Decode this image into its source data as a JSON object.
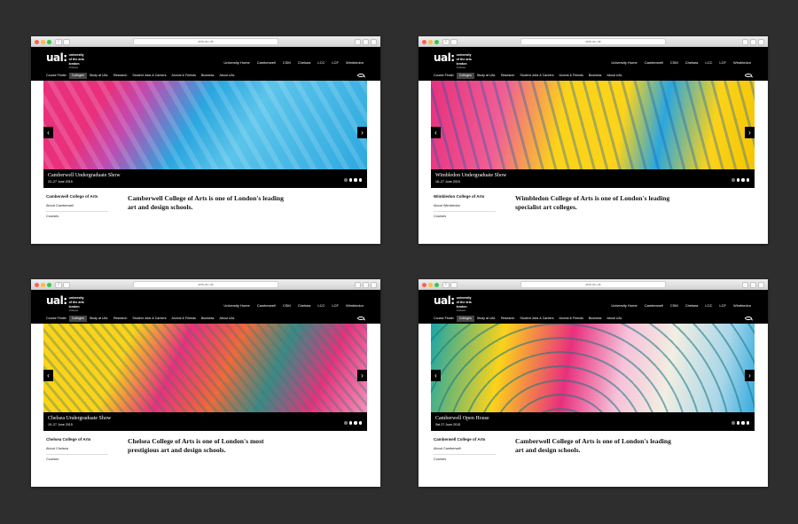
{
  "browser": {
    "url": "arts.ac.uk"
  },
  "header": {
    "logo_mark": "ual:",
    "logo_lines": [
      "university",
      "of the arts",
      "london"
    ],
    "logo_sub": "chelsea",
    "top_nav": [
      "University Home",
      "Camberwell",
      "CSM",
      "Chelsea",
      "LCC",
      "LCF",
      "Wimbledon"
    ],
    "main_nav": [
      "Course Finder",
      "Colleges",
      "Study at UAL",
      "Research",
      "Student Jobs & Careers",
      "Alumni & Friends",
      "Business",
      "About UAL"
    ],
    "active_nav": "Colleges"
  },
  "windows": [
    {
      "slide_title": "Camberwell Undergraduate Show",
      "slide_date": "22–27 June 2015",
      "sidebar_title": "Camberwell College of Arts",
      "sidebar_link": "About Camberwell",
      "sidebar_courses": "Courses",
      "intro": "Camberwell College of Arts is one of London's leading art and design schools.",
      "active_dot": 1
    },
    {
      "slide_title": "Wimbledon Undergraduate Show",
      "slide_date": "16–27 June 2015",
      "sidebar_title": "Wimbledon College of Arts",
      "sidebar_link": "About Wimbledon",
      "sidebar_courses": "Courses",
      "intro": "Wimbledon College of Arts is one of London's leading specialist art colleges.",
      "active_dot": 1
    },
    {
      "slide_title": "Chelsea Undergraduate Show",
      "slide_date": "19–27 June 2015",
      "sidebar_title": "Chelsea College of Arts",
      "sidebar_link": "About Chelsea",
      "sidebar_courses": "Courses",
      "intro": "Chelsea College of Arts is one of London's most prestigious art and design schools.",
      "active_dot": 1
    },
    {
      "slide_title": "Camberwell Open House",
      "slide_date": "Sat 27 June 2015",
      "sidebar_title": "Camberwell College of Arts",
      "sidebar_link": "About Camberwell",
      "sidebar_courses": "Courses",
      "intro": "Camberwell College of Arts is one of London's leading art and design schools.",
      "active_dot": 1
    }
  ],
  "icons": {
    "prev": "chevron-left-icon",
    "next": "chevron-right-icon",
    "search": "search-icon"
  },
  "colors": {
    "pink": "#e8307d",
    "yellow": "#fbd31a",
    "cyan": "#2aa6df",
    "teal": "#19a6a8",
    "black": "#000000"
  }
}
